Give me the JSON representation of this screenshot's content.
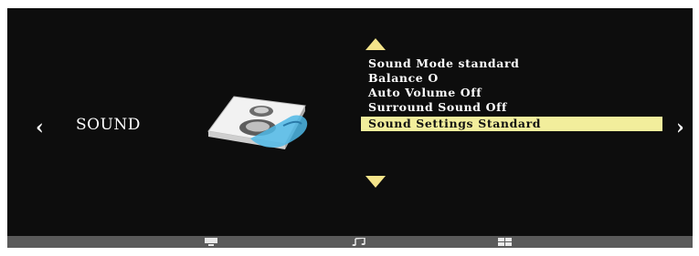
{
  "menu": {
    "title": "SOUND",
    "items": [
      {
        "label": "Sound  Mode",
        "value": "standard"
      },
      {
        "label": "Balance",
        "value": "O"
      },
      {
        "label": "Auto  Volume",
        "value": "Off"
      },
      {
        "label": "Surround Sound",
        "value": "Off"
      },
      {
        "label": "Sound  Settings",
        "value": "Standard"
      }
    ],
    "selected_index": 4
  },
  "nav": {
    "left_glyph": "‹",
    "right_glyph": "›",
    "up_icon": "up-arrow-icon",
    "down_icon": "down-arrow-icon"
  },
  "bottom_bar": {
    "icons": [
      "tv-icon",
      "music-note-icon",
      "grid-icon"
    ]
  },
  "colors": {
    "screen_bg": "#0d0d0d",
    "highlight": "#f2ee9c",
    "arrow": "#f4e48a",
    "bar": "#5a5a5a"
  }
}
